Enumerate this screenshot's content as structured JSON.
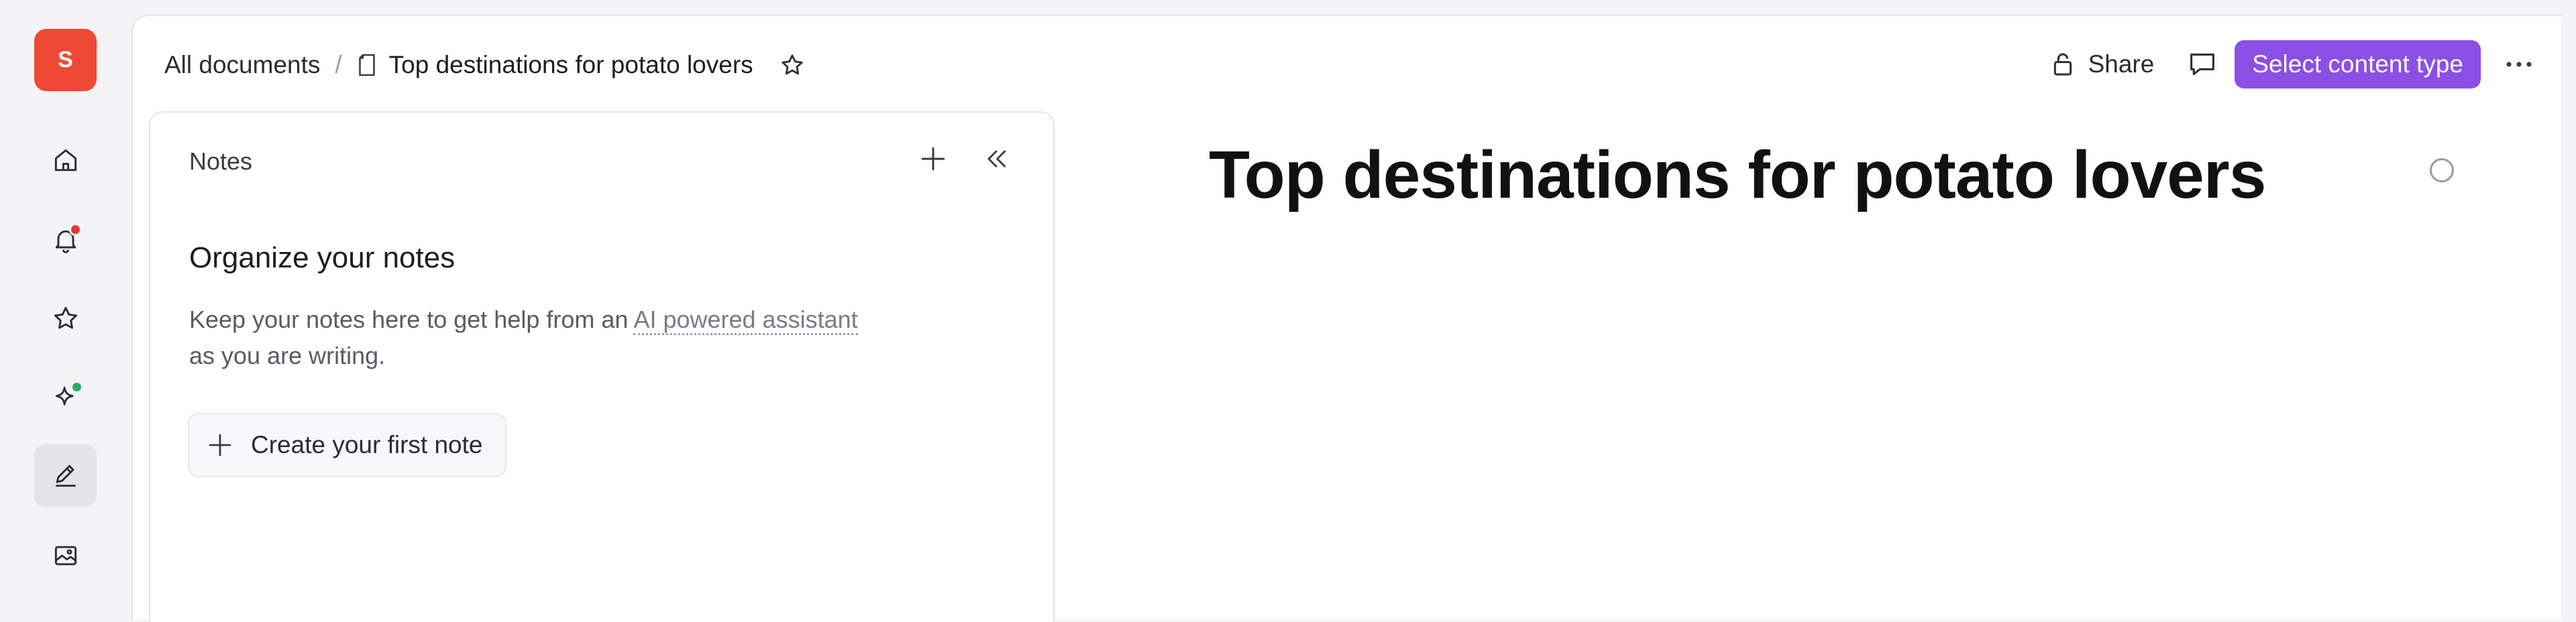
{
  "rail": {
    "avatar_initial": "S",
    "items": [
      {
        "icon": "home-icon"
      },
      {
        "icon": "bell-icon",
        "badge_color": "#e5372b"
      },
      {
        "icon": "star-icon"
      },
      {
        "icon": "sparkle-icon",
        "badge_color": "#27ae60"
      },
      {
        "icon": "pen-icon",
        "active": true
      },
      {
        "icon": "image-icon"
      }
    ]
  },
  "header": {
    "breadcrumb_root": "All documents",
    "breadcrumb_separator": "/",
    "breadcrumb_current": "Top destinations for potato lovers",
    "share_label": "Share",
    "primary_action_label": "Select content type"
  },
  "notes": {
    "title": "Notes",
    "empty_title": "Organize your notes",
    "empty_desc_before": "Keep your notes here to get help from an ",
    "empty_desc_link": "AI powered assistant",
    "empty_desc_after": "as you are writing.",
    "create_label": "Create your first note"
  },
  "editor": {
    "title": "Top destinations for potato lovers"
  },
  "colors": {
    "accent": "#8b4fe6",
    "avatar": "#ef4935"
  }
}
